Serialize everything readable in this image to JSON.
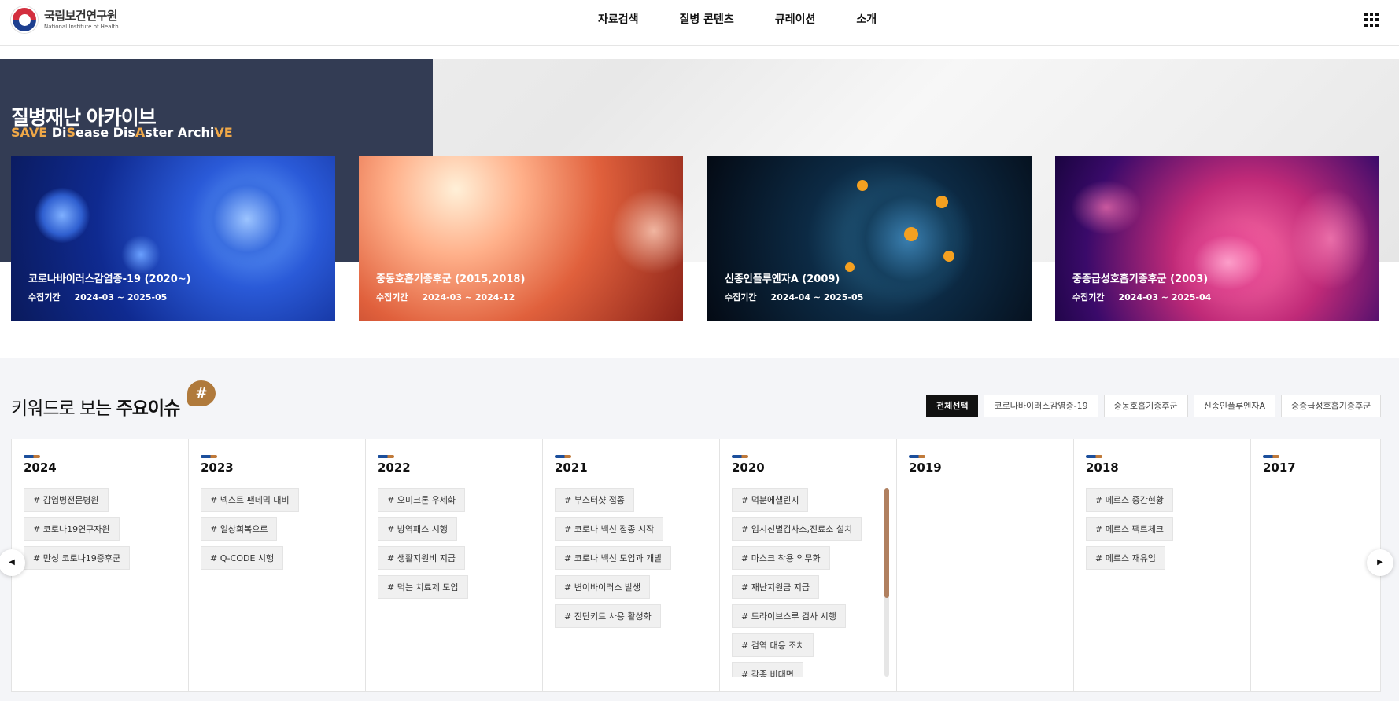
{
  "header": {
    "logo_ko": "국립보건연구원",
    "logo_en": "National Institute of Health",
    "nav": [
      "자료검색",
      "질병 콘텐츠",
      "큐레이션",
      "소개"
    ]
  },
  "hero": {
    "title": "질병재난 아카이브",
    "subtitle_parts": [
      "SAVE",
      " Di",
      "S",
      "ease Dis",
      "A",
      "ster Archi",
      "VE"
    ]
  },
  "cards": [
    {
      "title": "코로나바이러스감염증-19 (2020~)",
      "period_label": "수집기간",
      "period": "2024-03 ~ 2025-05"
    },
    {
      "title": "중동호흡기증후군 (2015,2018)",
      "period_label": "수집기간",
      "period": "2024-03 ~ 2024-12"
    },
    {
      "title": "신종인플루엔자A (2009)",
      "period_label": "수집기간",
      "period": "2024-04 ~ 2025-05"
    },
    {
      "title": "중증급성호흡기증후군 (2003)",
      "period_label": "수집기간",
      "period": "2024-03 ~ 2025-04"
    }
  ],
  "keywords": {
    "title_normal": "키워드로 보는 ",
    "title_bold": "주요이슈",
    "badge": "#",
    "filters": [
      "전체선택",
      "코로나바이러스감염증-19",
      "중동호흡기증후군",
      "신종인플루엔자A",
      "중증급성호흡기증후군"
    ],
    "years": [
      {
        "year": "2024",
        "tags": [
          "# 감염병전문병원",
          "# 코로나19연구자원",
          "# 만성 코로나19증후군"
        ]
      },
      {
        "year": "2023",
        "tags": [
          "# 넥스트 팬데믹 대비",
          "# 일상회복으로",
          "# Q-CODE 시행"
        ]
      },
      {
        "year": "2022",
        "tags": [
          "# 오미크론 우세화",
          "# 방역패스 시행",
          "# 생활지원비 지급",
          "# 먹는 치료제 도입"
        ]
      },
      {
        "year": "2021",
        "tags": [
          "# 부스터샷 접종",
          "# 코로나 백신 접종 시작",
          "# 코로나 백신 도입과 개발",
          "# 변이바이러스 발생",
          "# 진단키트 사용 활성화"
        ]
      },
      {
        "year": "2020",
        "tags": [
          "# 덕분에챌린지",
          "# 임시선별검사소,진료소 설치",
          "# 마스크 착용 의무화",
          "# 재난지원금 지급",
          "# 드라이브스루 검사 시행",
          "# 검역 대응 조치",
          "# 각종 비대면"
        ]
      },
      {
        "year": "2019",
        "tags": []
      },
      {
        "year": "2018",
        "tags": [
          "# 메르스 중간현황",
          "# 메르스 팩트체크",
          "# 메르스 재유입"
        ]
      },
      {
        "year": "2017",
        "tags": []
      }
    ]
  }
}
